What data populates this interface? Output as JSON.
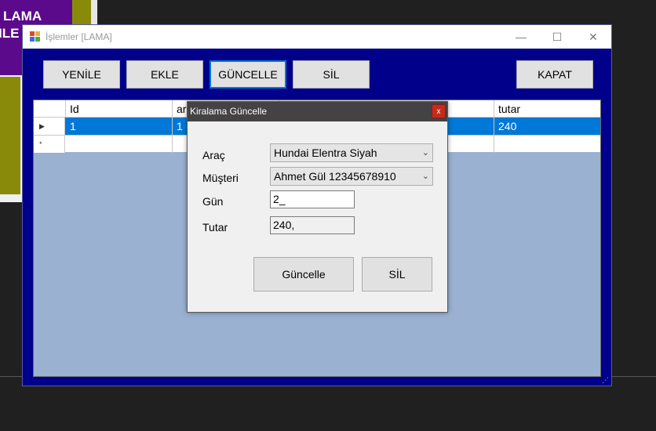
{
  "background_window": {
    "banner_line1": "LAMA",
    "banner_line2": "ILE"
  },
  "window": {
    "title": "İşlemler [LAMA]",
    "controls": {
      "minimize": "—",
      "maximize": "☐",
      "close": "✕"
    }
  },
  "toolbar": {
    "refresh_label": "YENİLE",
    "add_label": "EKLE",
    "update_label": "GÜNCELLE",
    "delete_label": "SİL",
    "close_label": "KAPAT"
  },
  "grid": {
    "columns": [
      "Id",
      "ar",
      "",
      "tutar"
    ],
    "rows": [
      {
        "marker": "▶",
        "cells": [
          "1",
          "1",
          "",
          "240"
        ]
      },
      {
        "marker": "*",
        "cells": [
          "",
          "",
          "",
          ""
        ]
      }
    ]
  },
  "dialog": {
    "title": "Kiralama Güncelle",
    "close_glyph": "x",
    "arac_label": "Araç",
    "arac_value": "Hundai Elentra Siyah",
    "musteri_label": "Müşteri",
    "musteri_value": "Ahmet Gül 12345678910",
    "gun_label": "Gün",
    "gun_value": "2_",
    "tutar_label": "Tutar",
    "tutar_value": "240,",
    "update_button": "Güncelle",
    "delete_button": "SİL"
  },
  "colors": {
    "window_bg": "#00008b",
    "grid_bg": "#9ab1d1",
    "selection": "#0078d7",
    "dialog_title_bg": "#444242",
    "dialog_close": "#c42b1c"
  }
}
